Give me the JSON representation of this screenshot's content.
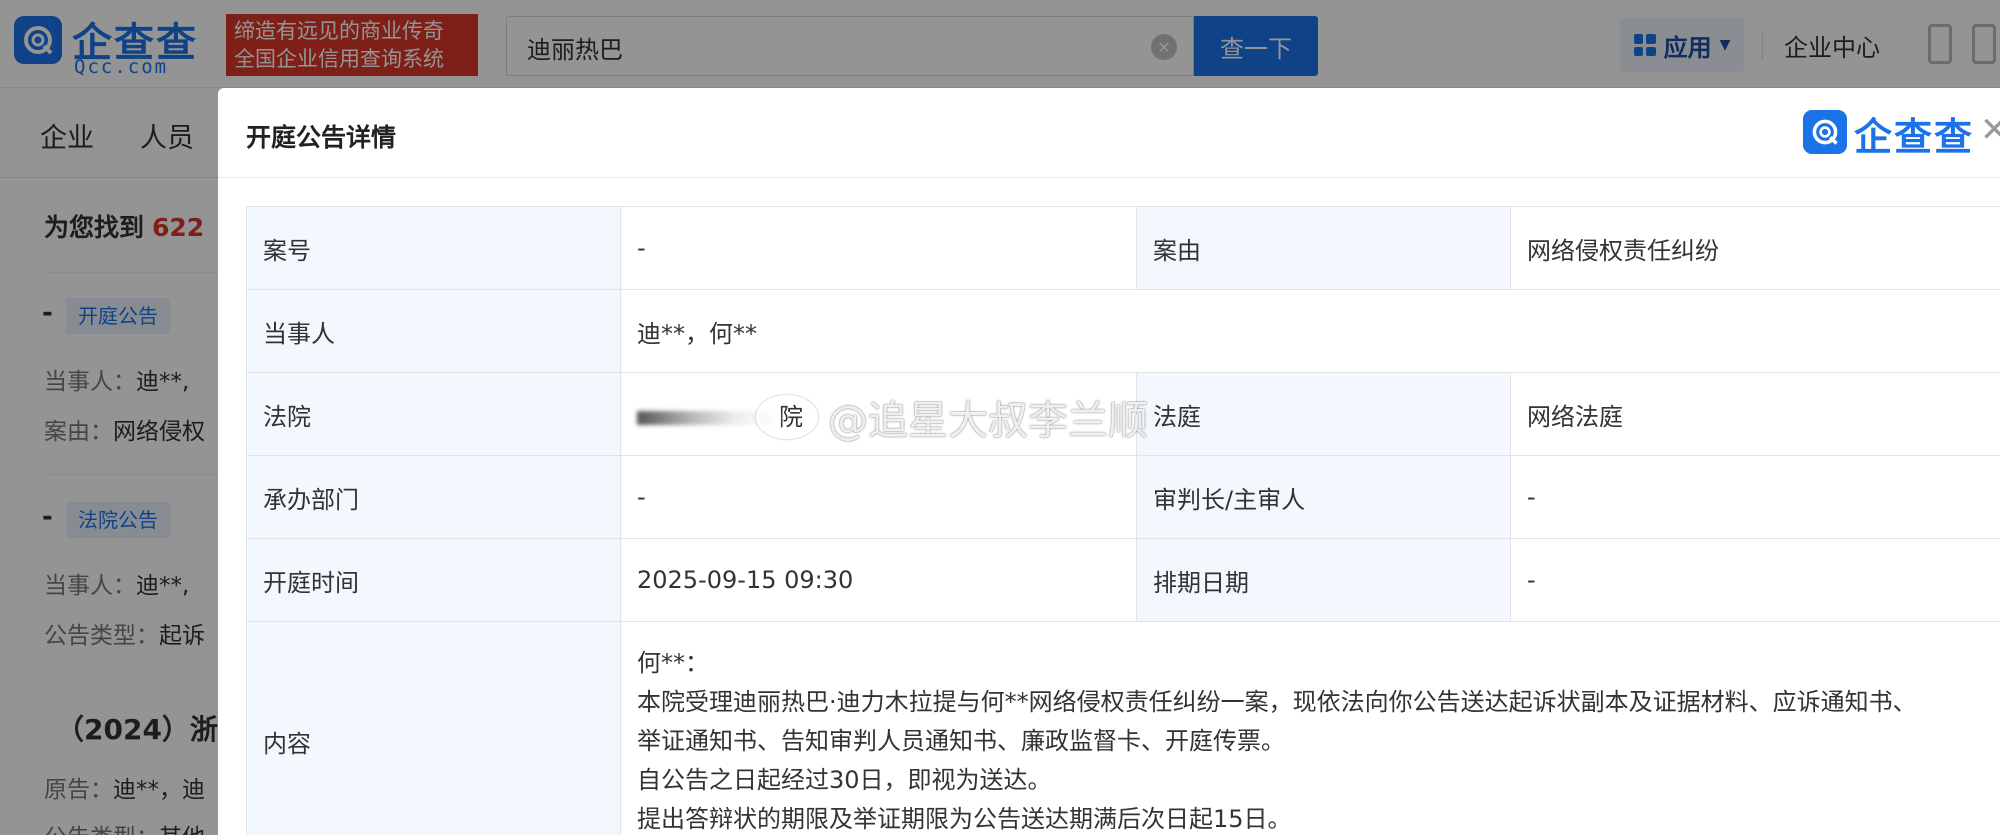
{
  "header": {
    "logo_text": "企查查",
    "logo_domain": "Qcc.com",
    "slogan_line1": "缔造有远见的商业传奇",
    "slogan_line2": "全国企业信用查询系统",
    "search_value": "迪丽热巴",
    "search_button": "查一下",
    "apps_label": "应用",
    "enterprise_center": "企业中心"
  },
  "nav": {
    "items": [
      "企业",
      "人员"
    ]
  },
  "results": {
    "found_prefix": "为您找到",
    "found_count": "622",
    "items": [
      {
        "dash": "-",
        "tag": "开庭公告",
        "line1_label": "当事人：",
        "line1_value": "迪**,",
        "line2_label": "案由：",
        "line2_value": "网络侵权"
      },
      {
        "dash": "-",
        "tag": "法院公告",
        "line1_label": "当事人：",
        "line1_value": "迪**,",
        "line2_label": "公告类型：",
        "line2_value": "起诉"
      }
    ],
    "case_title": "（2024）浙",
    "case_line1_label": "原告：",
    "case_line1_value": "迪**，迪",
    "case_line2_label": "公告类型：",
    "case_line2_value": "其他"
  },
  "modal": {
    "title": "开庭公告详情",
    "logo_text": "企查查",
    "close_symbol": "✕",
    "rows": {
      "case_no_label": "案号",
      "case_no_value": "-",
      "cause_label": "案由",
      "cause_value": "网络侵权责任纠纷",
      "party_label": "当事人",
      "party_value": "迪**，何**",
      "court_label": "法院",
      "court_value_tail": "院",
      "courtroom_label": "法庭",
      "courtroom_value": "网络法庭",
      "department_label": "承办部门",
      "department_value": "-",
      "judge_label": "审判长/主审人",
      "judge_value": "-",
      "hearing_time_label": "开庭时间",
      "hearing_time_value": "2025-09-15 09:30",
      "schedule_label": "排期日期",
      "schedule_value": "-",
      "content_label": "内容",
      "content_lines": [
        "何**：",
        "本院受理迪丽热巴·迪力木拉提与何**网络侵权责任纠纷一案，现依法向你公告送达起诉状副本及证据材料、应诉通知书、",
        "举证通知书、告知审判人员通知书、廉政监督卡、开庭传票。",
        "自公告之日起经过30日，即视为送达。",
        "提出答辩状的期限及举证期限为公告送达期满后次日起15日。"
      ]
    }
  },
  "watermark": {
    "text": "@追星大叔李兰顺"
  },
  "colors": {
    "brand_blue": "#1a73e8",
    "slogan_red": "#d9362a",
    "label_bg": "#f2f8fe"
  }
}
